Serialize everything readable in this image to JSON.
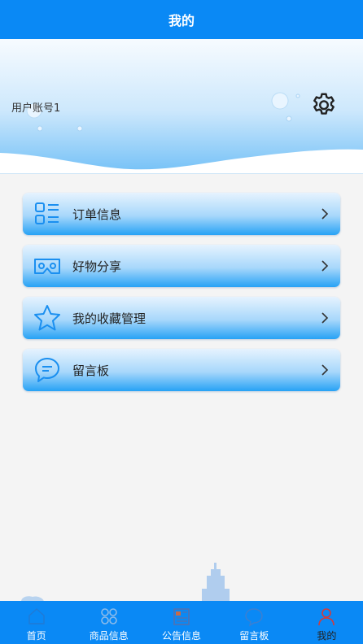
{
  "header": {
    "title": "我的"
  },
  "profile": {
    "account": "用户账号1",
    "settings_icon": "gear-icon"
  },
  "menu": [
    {
      "label": "订单信息",
      "icon": "order-list-icon"
    },
    {
      "label": "好物分享",
      "icon": "vr-glasses-icon"
    },
    {
      "label": "我的收藏管理",
      "icon": "star-icon"
    },
    {
      "label": "留言板",
      "icon": "chat-bubble-icon"
    }
  ],
  "tabbar": [
    {
      "label": "首页",
      "icon": "home-icon"
    },
    {
      "label": "商品信息",
      "icon": "grid-icon"
    },
    {
      "label": "公告信息",
      "icon": "notice-icon"
    },
    {
      "label": "留言板",
      "icon": "message-icon"
    },
    {
      "label": "我的",
      "icon": "user-icon",
      "active": true
    }
  ],
  "colors": {
    "primary": "#0a89f5",
    "accent": "#27a2f5"
  }
}
